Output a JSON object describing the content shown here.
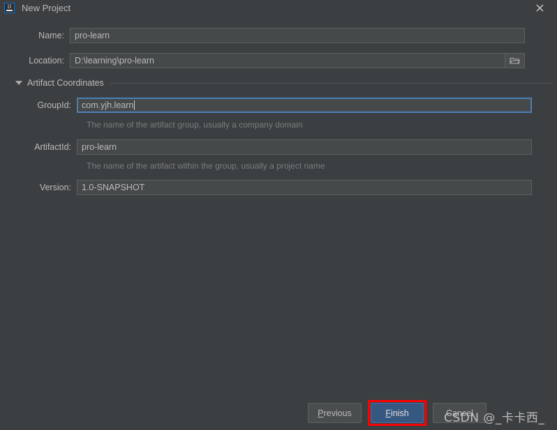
{
  "window": {
    "title": "New Project",
    "app_icon": "intellij-idea-icon",
    "close_icon": "close-icon"
  },
  "form": {
    "name": {
      "label": "Name:",
      "value": "pro-learn"
    },
    "location": {
      "label": "Location:",
      "value": "D:\\learning\\pro-learn",
      "browse_icon": "folder-icon"
    },
    "section": {
      "title": "Artifact Coordinates",
      "expander_icon": "triangle-down-icon"
    },
    "group_id": {
      "label": "GroupId:",
      "value": "com.yjh.learn",
      "hint": "The name of the artifact group, usually a company domain",
      "focused": true
    },
    "artifact_id": {
      "label": "ArtifactId:",
      "value": "pro-learn",
      "hint": "The name of the artifact within the group, usually a project name"
    },
    "version": {
      "label": "Version:",
      "value": "1.0-SNAPSHOT"
    }
  },
  "buttons": {
    "previous": {
      "prefix": "",
      "mnemonic": "P",
      "suffix": "revious"
    },
    "finish": {
      "prefix": "",
      "mnemonic": "F",
      "suffix": "inish"
    },
    "cancel": {
      "label": "Cancel"
    }
  },
  "annotation": {
    "highlight_color": "#ff0000",
    "target": "finish-button"
  },
  "watermark": {
    "text": "CSDN @_卡卡西_"
  },
  "colors": {
    "background": "#3c3f41",
    "field_background": "#45494a",
    "focus_border": "#4a7fbc",
    "primary_button": "#365880",
    "text": "#bbbbbb",
    "hint_text": "#7a7d7e"
  }
}
